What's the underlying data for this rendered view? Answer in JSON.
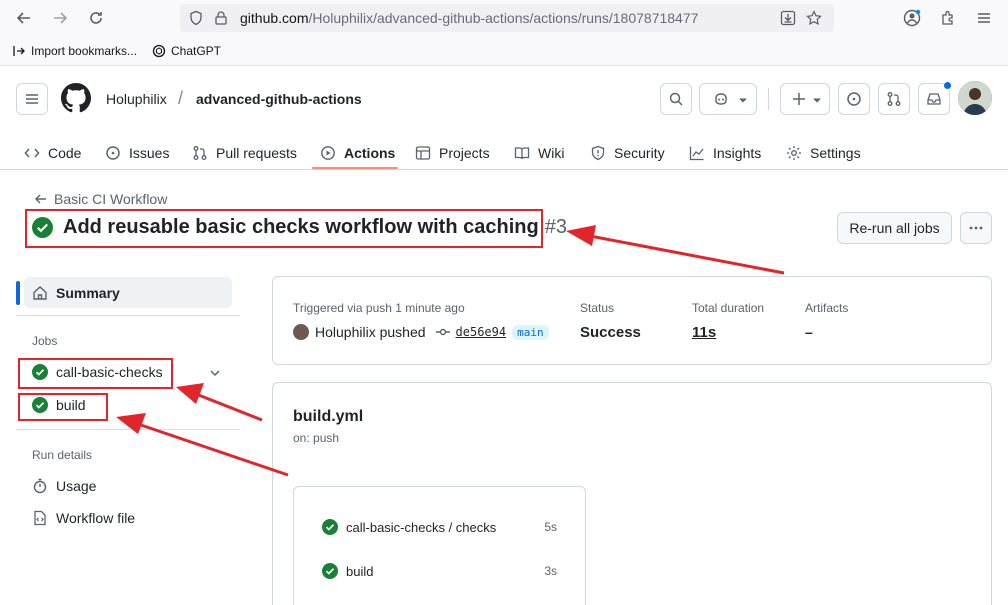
{
  "browser": {
    "url_host": "github.com",
    "url_path": "/Holuphilix/advanced-github-actions/actions/runs/18078718477",
    "bookmarks": [
      "Import bookmarks...",
      "ChatGPT"
    ]
  },
  "header": {
    "owner": "Holuphilix",
    "separator": "/",
    "repo": "advanced-github-actions",
    "tabs": [
      {
        "label": "Code"
      },
      {
        "label": "Issues"
      },
      {
        "label": "Pull requests"
      },
      {
        "label": "Actions"
      },
      {
        "label": "Projects"
      },
      {
        "label": "Wiki"
      },
      {
        "label": "Security"
      },
      {
        "label": "Insights"
      },
      {
        "label": "Settings"
      }
    ]
  },
  "run": {
    "back_label": "Basic CI Workflow",
    "title": "Add reusable basic checks workflow with caching",
    "number": "#3",
    "rerun_label": "Re-run all jobs"
  },
  "sidebar": {
    "summary_label": "Summary",
    "jobs_heading": "Jobs",
    "jobs": [
      "call-basic-checks",
      "build"
    ],
    "run_details_heading": "Run details",
    "details": [
      "Usage",
      "Workflow file"
    ]
  },
  "summary_card": {
    "triggered_label": "Triggered via push 1 minute ago",
    "actor_text": "Holuphilix pushed",
    "sha": "de56e94",
    "branch": "main",
    "status_label": "Status",
    "status_value": "Success",
    "duration_label": "Total duration",
    "duration_value": "11s",
    "artifacts_label": "Artifacts",
    "artifacts_value": "–"
  },
  "workflow_card": {
    "file": "build.yml",
    "trigger": "on: push",
    "jobs": [
      {
        "name": "call-basic-checks / checks",
        "time": "5s"
      },
      {
        "name": "build",
        "time": "3s"
      }
    ]
  },
  "colors": {
    "success": "#1a7f37",
    "accent": "#0969da",
    "annotation": "#e0262a",
    "tab_underline": "#fd8c73"
  }
}
